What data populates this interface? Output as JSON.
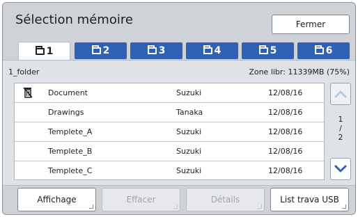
{
  "header": {
    "title": "Sélection mémoire",
    "close_label": "Fermer"
  },
  "tabs": [
    {
      "label": "1",
      "active": true
    },
    {
      "label": "2",
      "active": false
    },
    {
      "label": "3",
      "active": false
    },
    {
      "label": "4",
      "active": false
    },
    {
      "label": "5",
      "active": false
    },
    {
      "label": "6",
      "active": false
    }
  ],
  "folder": {
    "name": "1_folder",
    "free_space": "Zone libr: 11339MB (75%)"
  },
  "rows": [
    {
      "name": "Document",
      "owner": "Suzuki",
      "date": "12/08/16",
      "icon": "trash-icon"
    },
    {
      "name": "Drawings",
      "owner": "Tanaka",
      "date": "12/08/16"
    },
    {
      "name": "Templete_A",
      "owner": "Suzuki",
      "date": "12/08/16"
    },
    {
      "name": "Templete_B",
      "owner": "Suzuki",
      "date": "12/08/16"
    },
    {
      "name": "Templete_C",
      "owner": "Suzuki",
      "date": "12/08/16"
    }
  ],
  "pagination": {
    "current": "1",
    "separator": "/",
    "total": "2"
  },
  "footer": {
    "display_label": "Affichage",
    "delete_label": "Effacer",
    "details_label": "Détails",
    "usb_label": "List trava USB"
  },
  "colors": {
    "accent": "#2f62b6",
    "panel": "#cfd3d8",
    "scroll_arrow": "#2f62b6",
    "scroll_arrow_disabled": "#b9c9e4"
  }
}
